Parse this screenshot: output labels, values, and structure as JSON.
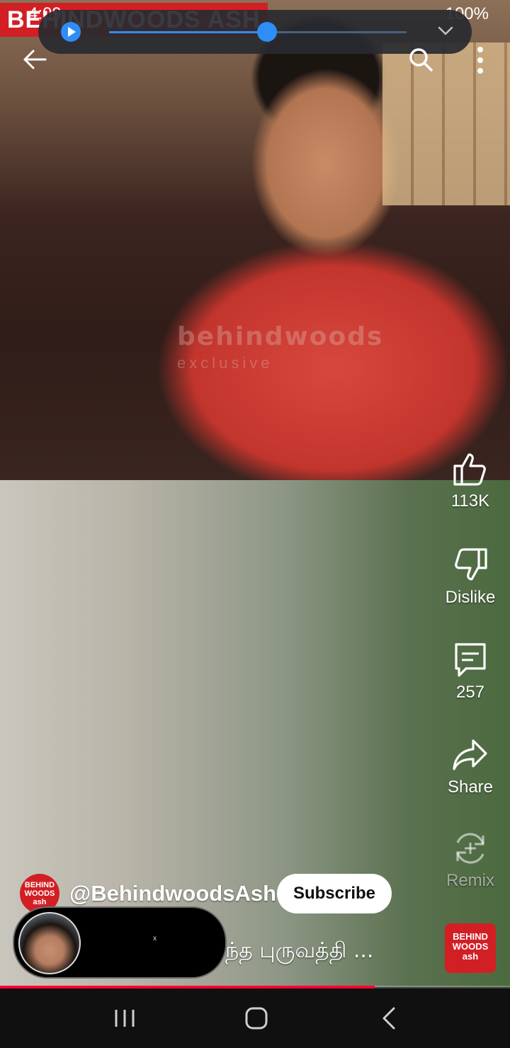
{
  "status_bar": {
    "left_text": "4:09",
    "right_text": "100%"
  },
  "brand": {
    "strip_text": "BEHINDWOODS ASH",
    "watermark_line1": "behindwoods",
    "watermark_line2": "exclusive",
    "color": "#d21f24"
  },
  "media_bar": {
    "progress": 0.53,
    "accent": "#2f8df7"
  },
  "top_icons": {
    "back": "back-arrow-icon",
    "search": "search-icon",
    "more": "more-vertical-icon"
  },
  "actions": {
    "like": {
      "icon": "thumbs-up-icon",
      "label": "113K"
    },
    "dislike": {
      "icon": "thumbs-down-icon",
      "label": "Dislike"
    },
    "comments": {
      "icon": "comment-icon",
      "label": "257"
    },
    "share": {
      "icon": "share-icon",
      "label": "Share"
    },
    "remix": {
      "icon": "remix-icon",
      "label": "Remix"
    }
  },
  "channel": {
    "avatar_text": "BEHIND WOODS ash",
    "handle": "@BehindwoodsAsh",
    "subscribe_label": "Subscribe",
    "thumb_text": "BEHIND WOODS ash"
  },
  "caption": {
    "text": "ந்த புருவத்தி ..."
  },
  "mini_player": {
    "close_glyph": "x"
  },
  "video_progress": {
    "fraction": 0.735,
    "color": "#ff0033"
  },
  "nav": {
    "recents": "recents-icon",
    "home": "home-icon",
    "back": "nav-back-icon"
  }
}
